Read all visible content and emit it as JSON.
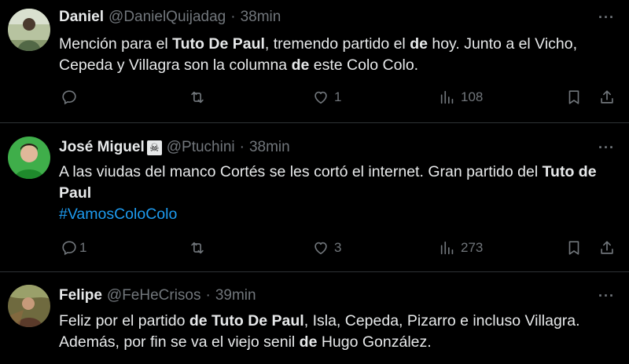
{
  "tweets": [
    {
      "name": "Daniel",
      "name_badge": "",
      "handle": "@DanielQuijadag",
      "separator": "·",
      "time": "38min",
      "more": "···",
      "text_parts": [
        {
          "t": "Mención para el ",
          "b": false
        },
        {
          "t": "Tuto De Paul",
          "b": true
        },
        {
          "t": ", tremendo partido el ",
          "b": false
        },
        {
          "t": "de",
          "b": true
        },
        {
          "t": " hoy. Junto a el Vicho, Cepeda y Villagra son la columna ",
          "b": false
        },
        {
          "t": "de",
          "b": true
        },
        {
          "t": " este Colo Colo.",
          "b": false
        }
      ],
      "hashtag": "",
      "replies": "",
      "retweets": "",
      "likes": "1",
      "views": "108"
    },
    {
      "name": "José Miguel",
      "name_badge": "☠",
      "handle": "@Ptuchini",
      "separator": "·",
      "time": "38min",
      "more": "···",
      "text_parts": [
        {
          "t": "A las viudas del manco Cortés se les cortó el internet. Gran partido del ",
          "b": false
        },
        {
          "t": "Tuto de Paul",
          "b": true
        }
      ],
      "hashtag": "#VamosColoColo",
      "replies": "1",
      "retweets": "",
      "likes": "3",
      "views": "273"
    },
    {
      "name": "Felipe",
      "name_badge": "",
      "handle": "@FeHeCrisos",
      "separator": "·",
      "time": "39min",
      "more": "···",
      "text_parts": [
        {
          "t": "Feliz por el partido ",
          "b": false
        },
        {
          "t": "de Tuto De Paul",
          "b": true
        },
        {
          "t": ", Isla, Cepeda, Pizarro e incluso Villagra. Además, por fin se va el viejo senil ",
          "b": false
        },
        {
          "t": "de",
          "b": true
        },
        {
          "t": " Hugo González.",
          "b": false
        }
      ],
      "hashtag": "",
      "replies": "",
      "retweets": "",
      "likes": "",
      "views": ""
    }
  ],
  "icons": [
    "avatar",
    "reply-icon",
    "retweet-icon",
    "like-icon",
    "views-icon",
    "bookmark-icon",
    "share-icon",
    "more-icon",
    "skull-crossbones-emoji"
  ],
  "colors": {
    "background": "#000000",
    "text": "#e7e9ea",
    "muted": "#71767b",
    "link": "#1d9bf0",
    "divider": "#2f3336"
  }
}
